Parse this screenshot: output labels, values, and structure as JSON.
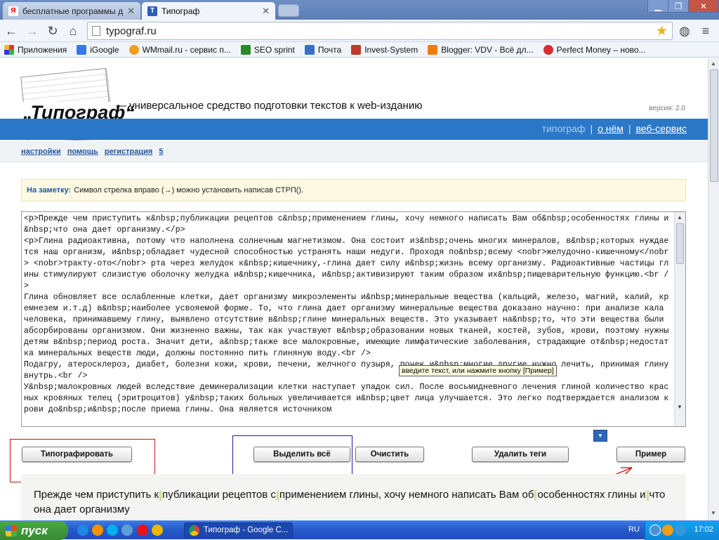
{
  "browser": {
    "tabs": [
      {
        "title": "бесплатные программы дл",
        "favicon": "Я",
        "active": false
      },
      {
        "title": "Типограф",
        "favicon": "T",
        "active": true
      }
    ],
    "url": "typograf.ru",
    "bookmarks": [
      {
        "label": "Приложения",
        "icon": "apps-grid-icon",
        "color": "#d44"
      },
      {
        "label": "iGoogle",
        "icon": "igoogle-icon",
        "color": "#3b78e7"
      },
      {
        "label": "WMmail.ru - сервис п...",
        "icon": "wmmail-icon",
        "color": "#f0a020"
      },
      {
        "label": "SEO sprint",
        "icon": "seosprint-icon",
        "color": "#2a8a2a"
      },
      {
        "label": "Почта",
        "icon": "mail-icon",
        "color": "#3a6fc7"
      },
      {
        "label": "Invest-System",
        "icon": "invest-icon",
        "color": "#c0392b"
      },
      {
        "label": "Blogger: VDV - Всё дл...",
        "icon": "blogger-icon",
        "color": "#f57c00"
      },
      {
        "label": "Perfect Money – ново...",
        "icon": "perfect-money-icon",
        "color": "#d32f2f"
      }
    ]
  },
  "site": {
    "logo": "„Типограф“",
    "tagline": "— универсальное средство подготовки текстов к web-изданию",
    "version": "версия: 2.0",
    "nav": {
      "current": "типограф",
      "sep": "|",
      "about": "о нём",
      "webservice": "веб-сервис"
    },
    "subnav": [
      {
        "label": "настройки"
      },
      {
        "label": "помощь"
      },
      {
        "label": "регистрация"
      },
      {
        "label": "5"
      }
    ],
    "note": {
      "label": "На заметку:",
      "text": "Символ стрелка вправо (→) можно установить написав СТРП()."
    }
  },
  "editor": {
    "text": "<p>Прежде чем приступить к&nbsp;публикации рецептов с&nbsp;применением глины, хочу немного написать Вам об&nbsp;особенностях глины и&nbsp;что она дает организму.</p>\n<p>Глина радиоактивна, потому что наполнена солнечным магнетизмом. Она состоит из&nbsp;очень многих минералов, в&nbsp;которых нуждается наш организм, и&nbsp;обладает чудесной способностью устранять наши недуги. Проходя по&nbsp;всему <nobr>желудочно-кишечному</nobr> <nobr>тракту-ото</nobr> рта через желудок к&nbsp;кишечнику,-глина дает силу и&nbsp;жизнь всему организму. Радиоактивные частицы глины стимулируют слизистую оболочку желудка и&nbsp;кишечника, и&nbsp;активизируют таким образом их&nbsp;пищеварительную функцию.<br />\nГлина обновляет все ослабленные клетки, дает организму микроэлементы и&nbsp;минеральные вещества (кальций, железо, магний, калий, кремнезем и.т.д) в&nbsp;наиболее усвояемой форме. То, что глина дает организму минеральные вещества доказано научно: при анализе кала человека, принимавшему глину, выявлено отсутствие в&nbsp;глине минеральных веществ. Это указывает на&nbsp;то, что эти вещества были абсорбированы организмом. Они жизненно важны, так как участвуют в&nbsp;образовании новых тканей, костей, зубов, крови, поэтому нужны детям в&nbsp;период роста. Значит дети, а&nbsp;также все малокровные, имеющие лимфатические заболевания, страдающие от&nbsp;недостатка минеральных веществ люди, должны постоянно пить глиняную воду.<br />\nПодагру, атеросклероз, диабет, болезни кожи, крови, печени, желчного пузыря, почек и&nbsp;многие другие нужно лечить, принимая глину внутрь.<br />\nУ&nbsp;малокровных людей вследствие деминерализации клетки наступает упадок сил. После восьмидневного лечения глиной количество красных кровяных телец (эритроцитов) у&nbsp;таких больных увеличивается и&nbsp;цвет лица улучшается. Это легко подтверждается анализом крови до&nbsp;и&nbsp;после приема глины. Она является источником",
    "tooltip": "введите текст, или нажмите кнопку [Пример]"
  },
  "buttons": {
    "typograph": "Типографировать",
    "select_all": "Выделить всё",
    "clear": "Очистить",
    "remove_tags": "Удалить теги",
    "example": "Пример"
  },
  "preview": {
    "parts": [
      "Прежде чем приступить к",
      "публикации рецептов с",
      "применением глины, хочу немного написать Вам об",
      "особенностях глины и",
      "что она дает организму"
    ]
  },
  "annotation_colors": {
    "red": "#d01010",
    "blue": "#1a1aa0"
  },
  "taskbar": {
    "start": "пуск",
    "task": "Типограф - Google C...",
    "lang": "RU",
    "time": "17:02"
  }
}
